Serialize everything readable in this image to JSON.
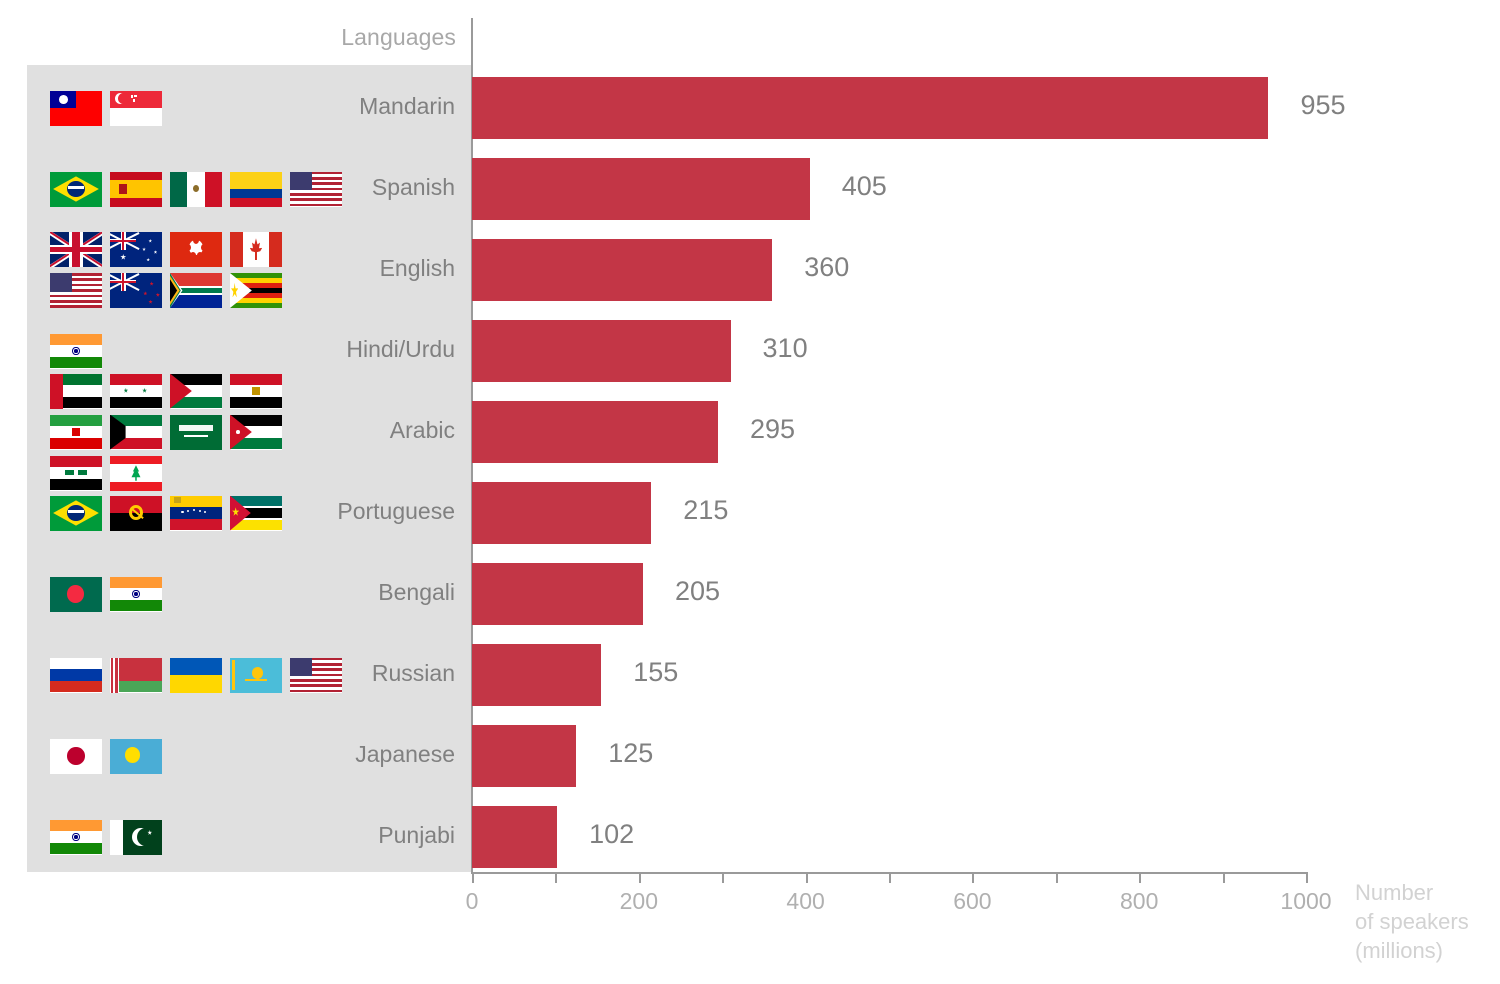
{
  "chart_data": {
    "type": "bar",
    "orientation": "horizontal",
    "title": "",
    "xlabel": "Number\nof speakers\n(millions)",
    "ylabel": "Languages",
    "categories": [
      "Mandarin",
      "Spanish",
      "English",
      "Hindi/Urdu",
      "Arabic",
      "Portuguese",
      "Bengali",
      "Russian",
      "Japanese",
      "Punjabi"
    ],
    "values": [
      955,
      405,
      360,
      310,
      295,
      215,
      205,
      155,
      125,
      102
    ],
    "value_labels": [
      "955",
      "405",
      "360",
      "310",
      "295",
      "215",
      "205",
      "155",
      "125",
      "102"
    ],
    "xlim": [
      0,
      1050
    ],
    "xticks": [
      0,
      100,
      200,
      300,
      400,
      500,
      600,
      700,
      800,
      900,
      1000
    ],
    "xtick_labels": [
      "0",
      "",
      "200",
      "",
      "400",
      "",
      "600",
      "",
      "800",
      "",
      "1000"
    ],
    "grid": false,
    "legend": "none",
    "bar_color": "#c33646",
    "panel_color": "#e0e0e0",
    "label_color": "#808080",
    "axis_color": "#9a9a9a",
    "tick_label_color": "#b0b0b0",
    "axis_title_color": "#d2d2d2"
  },
  "axis_titles": {
    "category": "Languages",
    "value_line1": "Number",
    "value_line2": "of speakers",
    "value_line3": "(millions)"
  },
  "rows": [
    {
      "label": "Mandarin",
      "value": 955,
      "value_label": "955",
      "flags": [
        "Taiwan",
        "Singapore"
      ]
    },
    {
      "label": "Spanish",
      "value": 405,
      "value_label": "405",
      "flags": [
        "Brazil",
        "Spain",
        "Mexico",
        "Colombia",
        "United States"
      ]
    },
    {
      "label": "English",
      "value": 360,
      "value_label": "360",
      "flags": [
        "United Kingdom",
        "Australia",
        "Hong Kong",
        "Canada",
        "United States",
        "New Zealand",
        "South Africa",
        "Zimbabwe"
      ]
    },
    {
      "label": "Hindi/Urdu",
      "value": 310,
      "value_label": "310",
      "flags": [
        "India"
      ]
    },
    {
      "label": "Arabic",
      "value": 295,
      "value_label": "295",
      "flags": [
        "United Arab Emirates",
        "Syria",
        "Palestine",
        "Egypt",
        "Iran",
        "Kuwait",
        "Saudi Arabia",
        "Jordan",
        "Iraq",
        "Lebanon"
      ]
    },
    {
      "label": "Portuguese",
      "value": 215,
      "value_label": "215",
      "flags": [
        "Brazil",
        "Angola",
        "Venezuela",
        "Mozambique"
      ]
    },
    {
      "label": "Bengali",
      "value": 205,
      "value_label": "205",
      "flags": [
        "Bangladesh",
        "India"
      ]
    },
    {
      "label": "Russian",
      "value": 155,
      "value_label": "155",
      "flags": [
        "Russia",
        "Belarus",
        "Ukraine",
        "Kazakhstan",
        "United States"
      ]
    },
    {
      "label": "Japanese",
      "value": 125,
      "value_label": "125",
      "flags": [
        "Japan",
        "Palau"
      ]
    },
    {
      "label": "Punjabi",
      "value": 102,
      "value_label": "102",
      "flags": [
        "India",
        "Pakistan"
      ]
    }
  ],
  "ticks": [
    {
      "value": 0,
      "label": "0"
    },
    {
      "value": 100,
      "label": ""
    },
    {
      "value": 200,
      "label": "200"
    },
    {
      "value": 300,
      "label": ""
    },
    {
      "value": 400,
      "label": "400"
    },
    {
      "value": 500,
      "label": ""
    },
    {
      "value": 600,
      "label": "600"
    },
    {
      "value": 700,
      "label": ""
    },
    {
      "value": 800,
      "label": "800"
    },
    {
      "value": 900,
      "label": ""
    },
    {
      "value": 1000,
      "label": "1000"
    }
  ]
}
